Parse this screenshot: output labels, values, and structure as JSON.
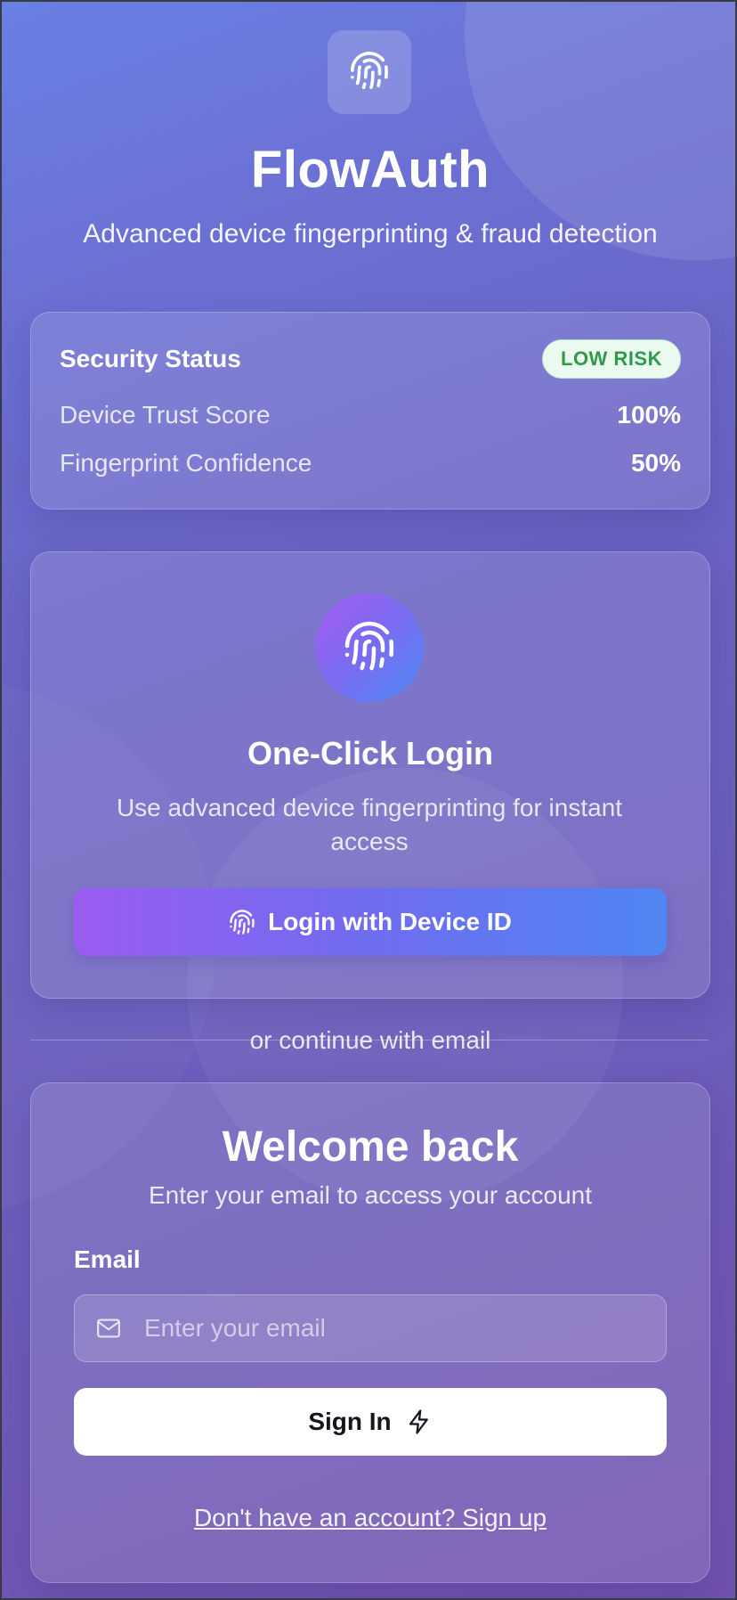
{
  "app": {
    "title": "FlowAuth",
    "subtitle": "Advanced device fingerprinting & fraud detection",
    "logo_icon": "fingerprint-icon"
  },
  "security_status": {
    "title": "Security Status",
    "risk_badge": "LOW RISK",
    "risk_color": "#2f9a4c",
    "metrics": [
      {
        "label": "Device Trust Score",
        "value": "100%"
      },
      {
        "label": "Fingerprint Confidence",
        "value": "50%"
      }
    ]
  },
  "one_click": {
    "icon": "fingerprint-icon",
    "title": "One-Click Login",
    "description": "Use advanced device fingerprinting for instant access",
    "button_label": "Login with Device ID",
    "button_icon": "fingerprint-icon"
  },
  "divider": {
    "text": "or continue with email"
  },
  "email_login": {
    "title": "Welcome back",
    "subtitle": "Enter your email to access your account",
    "email_label": "Email",
    "email_placeholder": "Enter your email",
    "email_value": "",
    "email_icon": "mail-icon",
    "signin_label": "Sign In",
    "signin_icon": "lightning-icon",
    "signup_link": "Don't have an account? Sign up"
  },
  "colors": {
    "background_start": "#6a80e4",
    "background_end": "#7152ae",
    "button_gradient_start": "#9a5cf0",
    "button_gradient_end": "#4f86f2",
    "badge_background": "#eafaee"
  }
}
